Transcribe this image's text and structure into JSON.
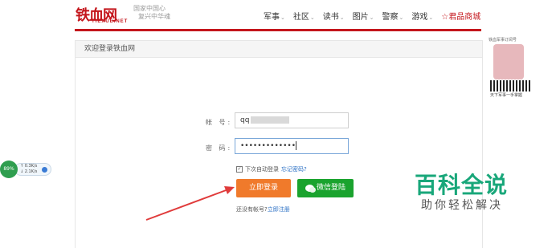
{
  "header": {
    "logo_text": "铁血网",
    "logo_sub": "TIEXUE.NET",
    "slogan_lines": [
      "国家中国心",
      "复兴中华魂"
    ],
    "nav": [
      {
        "label": "军事",
        "caret": "⌄"
      },
      {
        "label": "社区",
        "caret": "⌄"
      },
      {
        "label": "读书",
        "caret": "⌄"
      },
      {
        "label": "图片",
        "caret": "⌄"
      },
      {
        "label": "警察",
        "caret": "⌄"
      },
      {
        "label": "游戏",
        "caret": "⌄"
      },
      {
        "label": "☆君品商城",
        "caret": ""
      }
    ],
    "brand_color": "#c4161c"
  },
  "panel": {
    "title": "欢迎登录铁血网"
  },
  "form": {
    "account_label": "帐 号:",
    "account_value": "qq",
    "password_label": "密 码:",
    "password_value": "•••••••••••••",
    "remember_text": "下次自动登录",
    "remember_checked": "✓",
    "forgot_link": "忘记密码?",
    "login_button": "立即登录",
    "wechat_button": "微信登陆",
    "signup_prompt": "还没有帐号?",
    "signup_link": "立即注册",
    "login_color": "#f07a2b",
    "wechat_color": "#1aa32e"
  },
  "sidebar": {
    "qr_title": "铁血军事订阅号",
    "qr_caption": "天下军事一手掌握"
  },
  "speed_widget": {
    "percent": "89%",
    "up": "↑ 0.3K/s",
    "down": "↓ 2.1K/s"
  },
  "watermark": {
    "big": "百科全说",
    "small": "助你轻松解决"
  }
}
